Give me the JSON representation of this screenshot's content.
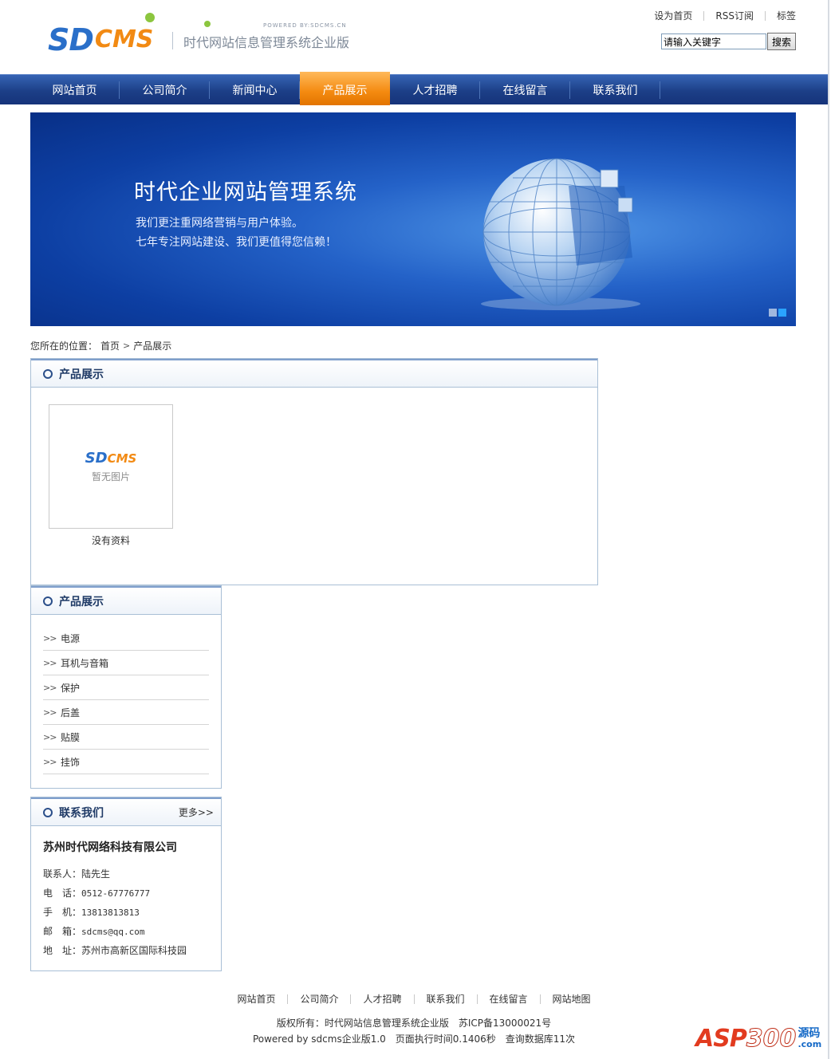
{
  "header": {
    "logo_sd": "SD",
    "logo_cms": "CMS",
    "powered": "POWERED BY:SDCMS.CN",
    "slogan": "时代网站信息管理系统企业版",
    "toplinks": [
      "设为首页",
      "RSS订阅",
      "标签"
    ],
    "search": {
      "placeholder": "请输入关键字",
      "value": "请输入关键字",
      "button": "搜索"
    }
  },
  "nav": {
    "items": [
      "网站首页",
      "公司简介",
      "新闻中心",
      "产品展示",
      "人才招聘",
      "在线留言",
      "联系我们"
    ],
    "active_index": 3
  },
  "banner": {
    "title": "时代企业网站管理系统",
    "line1": "我们更注重网络营销与用户体验。",
    "line2": "七年专注网站建设、我们更值得您信赖！",
    "slide_count": 2,
    "active_slide": 2
  },
  "breadcrumb": {
    "label": "您所在的位置：",
    "home": "首页",
    "arrow": ">",
    "current": "产品展示"
  },
  "main_panel": {
    "title": "产品展示",
    "thumb_logo_sd": "SD",
    "thumb_logo_cms": "CMS",
    "thumb_text": "暂无图片",
    "caption": "没有资料"
  },
  "category_panel": {
    "title": "产品展示",
    "chevron": ">>",
    "items": [
      "电源",
      "耳机与音箱",
      "保护",
      "后盖",
      "贴膜",
      "挂饰"
    ]
  },
  "contact_panel": {
    "title": "联系我们",
    "more": "更多>>",
    "company": "苏州时代网络科技有限公司",
    "rows": [
      {
        "label": "联系人：",
        "value": "陆先生"
      },
      {
        "label": "电　话：",
        "value": "0512-67776777"
      },
      {
        "label": "手　机：",
        "value": "13813813813"
      },
      {
        "label": "邮　箱：",
        "value": "sdcms@qq.com"
      },
      {
        "label": "地　址：",
        "value": "苏州市高新区国际科技园"
      }
    ]
  },
  "footer": {
    "links": [
      "网站首页",
      "公司简介",
      "人才招聘",
      "联系我们",
      "在线留言",
      "网站地图"
    ],
    "copyright": "版权所有：时代网站信息管理系统企业版　苏ICP备13000021号",
    "powered_by": "Powered by sdcms企业版1.0　页面执行时间0.1406秒　查询数据库11次"
  },
  "watermark": {
    "asp": "ASP",
    "num": "300",
    "yuan": "源码",
    "com": ".com"
  },
  "colors": {
    "nav_bg": "#1c3f87",
    "nav_active": "#f48a10",
    "banner_bg": "#1a56bd",
    "panel_border": "#a9bfd6",
    "title_text": "#1f3a66"
  }
}
